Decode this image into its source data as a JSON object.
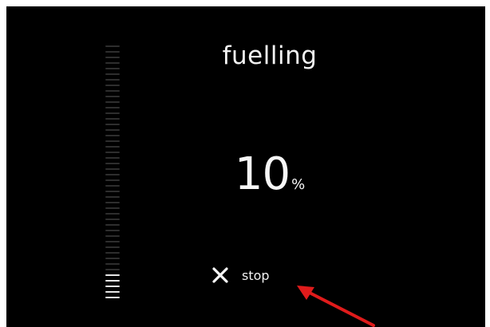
{
  "screen": {
    "title": "fuelling",
    "progress_value": "10",
    "progress_unit": "%",
    "stop_label": "stop"
  },
  "gauge": {
    "level_fraction": 0.1
  },
  "icons": {
    "stop": "close-icon",
    "gauge": "fuel-level-gauge"
  },
  "colors": {
    "background": "#000000",
    "text": "#f2f2f2",
    "annotation": "#e01b1b"
  }
}
